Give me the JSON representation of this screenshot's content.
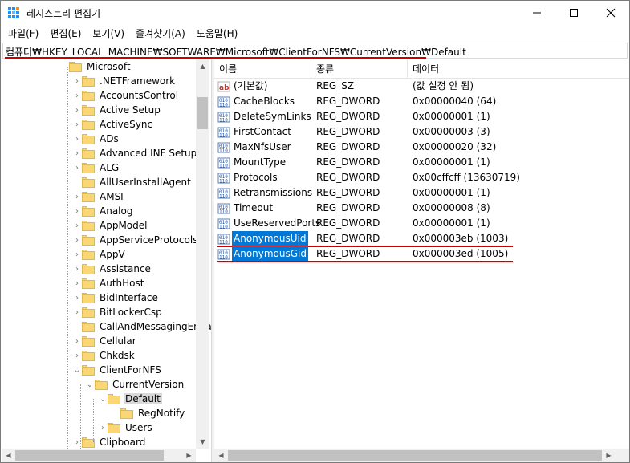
{
  "window": {
    "title": "레지스트리 편집기"
  },
  "menu": [
    "파일(F)",
    "편집(E)",
    "보기(V)",
    "즐겨찾기(A)",
    "도움말(H)"
  ],
  "address": "컴퓨터₩HKEY_LOCAL_MACHINE₩SOFTWARE₩Microsoft₩ClientForNFS₩CurrentVersion₩Default",
  "tree": [
    {
      "label": "Microsoft",
      "arrow": "",
      "depth": 0
    },
    {
      "label": ".NETFramework",
      "arrow": "›",
      "depth": 1
    },
    {
      "label": "AccountsControl",
      "arrow": "›",
      "depth": 1
    },
    {
      "label": "Active Setup",
      "arrow": "›",
      "depth": 1
    },
    {
      "label": "ActiveSync",
      "arrow": "›",
      "depth": 1
    },
    {
      "label": "ADs",
      "arrow": "›",
      "depth": 1
    },
    {
      "label": "Advanced INF Setup",
      "arrow": "›",
      "depth": 1
    },
    {
      "label": "ALG",
      "arrow": "›",
      "depth": 1
    },
    {
      "label": "AllUserInstallAgent",
      "arrow": "",
      "depth": 1
    },
    {
      "label": "AMSI",
      "arrow": "›",
      "depth": 1
    },
    {
      "label": "Analog",
      "arrow": "›",
      "depth": 1
    },
    {
      "label": "AppModel",
      "arrow": "›",
      "depth": 1
    },
    {
      "label": "AppServiceProtocols",
      "arrow": "›",
      "depth": 1
    },
    {
      "label": "AppV",
      "arrow": "›",
      "depth": 1
    },
    {
      "label": "Assistance",
      "arrow": "›",
      "depth": 1
    },
    {
      "label": "AuthHost",
      "arrow": "›",
      "depth": 1
    },
    {
      "label": "BidInterface",
      "arrow": "›",
      "depth": 1
    },
    {
      "label": "BitLockerCsp",
      "arrow": "›",
      "depth": 1
    },
    {
      "label": "CallAndMessagingEnhanc",
      "arrow": "",
      "depth": 1
    },
    {
      "label": "Cellular",
      "arrow": "›",
      "depth": 1
    },
    {
      "label": "Chkdsk",
      "arrow": "›",
      "depth": 1
    },
    {
      "label": "ClientForNFS",
      "arrow": "⌄",
      "depth": 1
    },
    {
      "label": "CurrentVersion",
      "arrow": "⌄",
      "depth": 2
    },
    {
      "label": "Default",
      "arrow": "⌄",
      "depth": 3,
      "selected": true
    },
    {
      "label": "RegNotify",
      "arrow": "",
      "depth": 4
    },
    {
      "label": "Users",
      "arrow": "›",
      "depth": 3
    },
    {
      "label": "Clipboard",
      "arrow": "›",
      "depth": 1
    }
  ],
  "columns": {
    "name": "이름",
    "type": "종류",
    "data": "데이터"
  },
  "values": [
    {
      "name": "(기본값)",
      "type": "REG_SZ",
      "data": "(값 설정 안 됨)",
      "icon": "string-value-icon"
    },
    {
      "name": "CacheBlocks",
      "type": "REG_DWORD",
      "data": "0x00000040 (64)",
      "icon": "dword-value-icon"
    },
    {
      "name": "DeleteSymLinks",
      "type": "REG_DWORD",
      "data": "0x00000001 (1)",
      "icon": "dword-value-icon"
    },
    {
      "name": "FirstContact",
      "type": "REG_DWORD",
      "data": "0x00000003 (3)",
      "icon": "dword-value-icon"
    },
    {
      "name": "MaxNfsUser",
      "type": "REG_DWORD",
      "data": "0x00000020 (32)",
      "icon": "dword-value-icon"
    },
    {
      "name": "MountType",
      "type": "REG_DWORD",
      "data": "0x00000001 (1)",
      "icon": "dword-value-icon"
    },
    {
      "name": "Protocols",
      "type": "REG_DWORD",
      "data": "0x00cffcff (13630719)",
      "icon": "dword-value-icon"
    },
    {
      "name": "Retransmissions",
      "type": "REG_DWORD",
      "data": "0x00000001 (1)",
      "icon": "dword-value-icon"
    },
    {
      "name": "Timeout",
      "type": "REG_DWORD",
      "data": "0x00000008 (8)",
      "icon": "dword-value-icon"
    },
    {
      "name": "UseReservedPorts",
      "type": "REG_DWORD",
      "data": "0x00000001 (1)",
      "icon": "dword-value-icon"
    },
    {
      "name": "AnonymousUid",
      "type": "REG_DWORD",
      "data": "0x000003eb (1003)",
      "icon": "dword-value-icon",
      "selected": true
    },
    {
      "name": "AnonymousGid",
      "type": "REG_DWORD",
      "data": "0x000003ed (1005)",
      "icon": "dword-value-icon",
      "selected": true
    }
  ],
  "colors": {
    "highlight": "#0078d7",
    "annotation": "#cc0000",
    "folder": "#f8d774"
  }
}
